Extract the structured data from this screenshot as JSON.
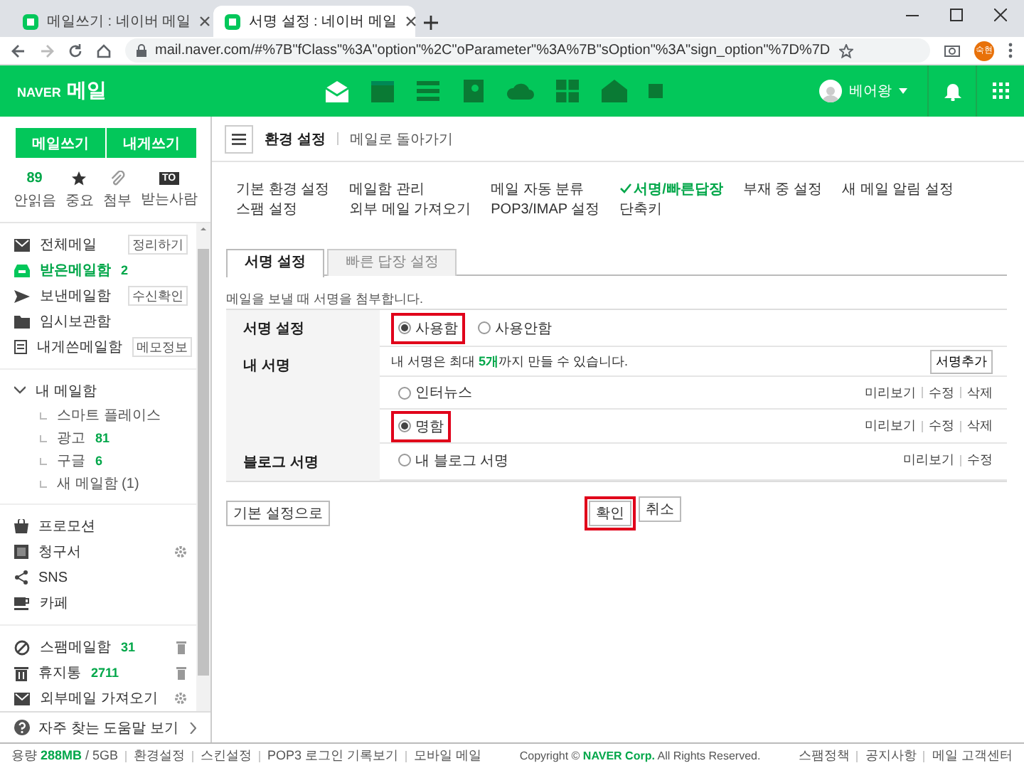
{
  "browser": {
    "tabs": [
      {
        "title": "메일쓰기 : 네이버 메일",
        "selected": false
      },
      {
        "title": "서명 설정 : 네이버 메일",
        "selected": true
      }
    ],
    "url": "mail.naver.com/#%7B\"fClass\"%3A\"option\"%2C\"oParameter\"%3A%7B\"sOption\"%3A\"sign_option\"%7D%7D",
    "profile": "숙현"
  },
  "header": {
    "brand": "NAVER",
    "product": "메일",
    "user": "베어왕"
  },
  "sidebar": {
    "buttons": [
      "메일쓰기",
      "내게쓰기"
    ],
    "quick": [
      {
        "kind": "count",
        "count": "89",
        "label": "안읽음"
      },
      {
        "kind": "star",
        "label": "중요"
      },
      {
        "kind": "clip",
        "label": "첨부"
      },
      {
        "kind": "to",
        "badge": "TO",
        "label": "받는사람"
      }
    ],
    "mailboxes": [
      {
        "kind": "all",
        "label": "전체메일",
        "action": "정리하기",
        "selected": false
      },
      {
        "kind": "inbox",
        "label": "받은메일함",
        "count": "2",
        "selected": true
      },
      {
        "kind": "sent",
        "label": "보낸메일함",
        "action": "수신확인",
        "selected": false
      },
      {
        "kind": "draft",
        "label": "임시보관함",
        "selected": false
      },
      {
        "kind": "self",
        "label": "내게쓴메일함",
        "action": "메모정보",
        "selected": false
      }
    ],
    "my_mailboxes": {
      "label": "내 메일함",
      "expanded": true,
      "children": [
        {
          "label": "스마트 플레이스"
        },
        {
          "label": "광고",
          "count": "81"
        },
        {
          "label": "구글",
          "count": "6"
        },
        {
          "label": "새 메일함 (1)"
        }
      ]
    },
    "categories": [
      {
        "kind": "promo",
        "label": "프로모션"
      },
      {
        "kind": "bill",
        "label": "청구서"
      },
      {
        "kind": "sns",
        "label": "SNS"
      },
      {
        "kind": "cafe",
        "label": "카페"
      }
    ],
    "special": [
      {
        "kind": "spam",
        "label": "스팸메일함",
        "count": "31"
      },
      {
        "kind": "trash",
        "label": "휴지통",
        "count": "2711"
      },
      {
        "kind": "external",
        "label": "외부메일 가져오기"
      }
    ],
    "help": "자주 찾는 도움말 보기"
  },
  "main": {
    "title": "환경 설정",
    "back_link": "메일로 돌아가기",
    "menu": [
      {
        "label": "기본 환경 설정",
        "selected": false
      },
      {
        "label": "메일함 관리",
        "selected": false
      },
      {
        "label": "메일 자동 분류",
        "selected": false
      },
      {
        "label": "서명/빠른답장",
        "selected": true
      },
      {
        "label": "부재 중 설정",
        "selected": false
      },
      {
        "label": "새 메일 알림 설정",
        "selected": false
      },
      {
        "label": "스팸 설정",
        "selected": false
      },
      {
        "label": "외부 메일 가져오기",
        "selected": false
      },
      {
        "label": "POP3/IMAP 설정",
        "selected": false
      },
      {
        "label": "단축키",
        "selected": false
      }
    ],
    "tabs": [
      {
        "label": "서명 설정",
        "selected": true
      },
      {
        "label": "빠른 답장 설정",
        "selected": false
      }
    ],
    "description": "메일을 보낼 때 서명을 첨부합니다.",
    "rows": [
      {
        "kind": "radios",
        "label": "서명 설정",
        "options": [
          {
            "label": "사용함",
            "selected": true,
            "highlighted": true
          },
          {
            "label": "사용안함",
            "selected": false,
            "highlighted": false
          }
        ]
      },
      {
        "kind": "list",
        "label": "내 서명",
        "info": "내 서명은 최대 **5개**까지 만들 수 있습니다.",
        "add_button": "서명추가",
        "items": [
          {
            "name": "인터뉴스",
            "selected": false,
            "highlighted": false,
            "actions": [
              "미리보기",
              "수정",
              "삭제"
            ]
          },
          {
            "name": "명함",
            "selected": true,
            "highlighted": true,
            "actions": [
              "미리보기",
              "수정",
              "삭제"
            ]
          }
        ]
      },
      {
        "kind": "list",
        "label": "블로그 서명",
        "items": [
          {
            "name": "내 블로그 서명",
            "selected": false,
            "highlighted": false,
            "actions": [
              "미리보기",
              "수정"
            ]
          }
        ]
      }
    ],
    "buttons": [
      {
        "kind": "reset",
        "label": "기본 설정으로",
        "highlighted": false
      },
      {
        "kind": "confirm",
        "label": "확인",
        "highlighted": true
      },
      {
        "kind": "cancel",
        "label": "취소",
        "highlighted": false
      }
    ]
  },
  "footer": {
    "quota": "용량 **288MB** / 5GB",
    "links": [
      "환경설정",
      "스킨설정",
      "POP3 로그인 기록보기",
      "모바일 메일"
    ],
    "copyright": "Copyright © **NAVER Corp.** All Rights Reserved.",
    "right_links": [
      "스팸정책",
      "공지사항",
      "메일 고객센터"
    ]
  }
}
